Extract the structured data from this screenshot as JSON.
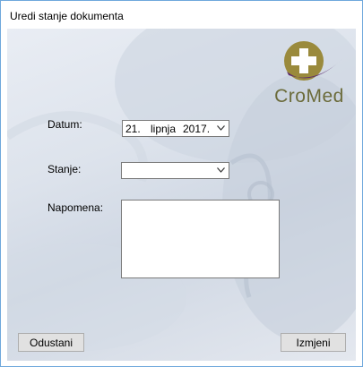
{
  "window": {
    "title": "Uredi stanje dokumenta"
  },
  "logo": {
    "text": "CroMed",
    "icon": "medical-cross-icon"
  },
  "form": {
    "date_label": "Datum:",
    "date": {
      "day": "21.",
      "month": "lipnja",
      "year": "2017."
    },
    "status_label": "Stanje:",
    "status_value": "",
    "note_label": "Napomena:",
    "note_value": ""
  },
  "buttons": {
    "cancel": "Odustani",
    "change": "Izmjeni"
  },
  "colors": {
    "logo_gold": "#9a8a3c",
    "logo_purple": "#5b2a6e",
    "window_border": "#6fa8dc"
  }
}
